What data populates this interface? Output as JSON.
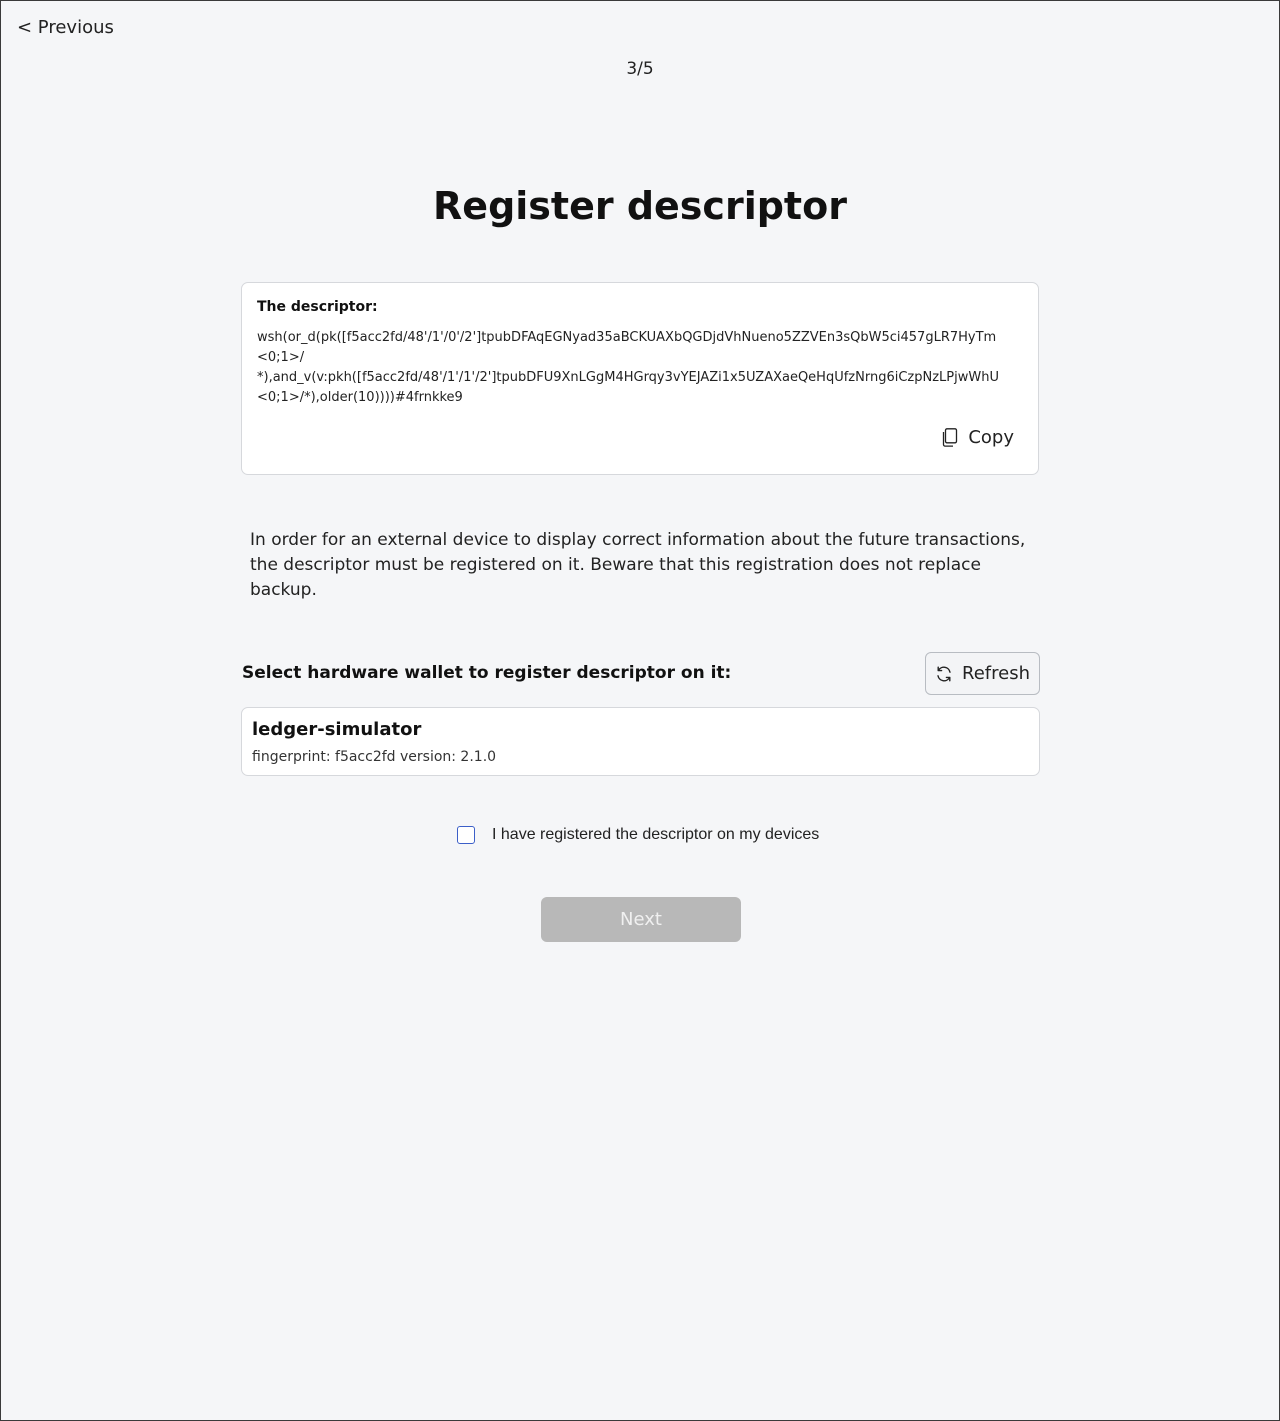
{
  "nav": {
    "previous_label": "< Previous",
    "step": "3/5"
  },
  "page": {
    "title": "Register descriptor"
  },
  "descriptor": {
    "label": "The descriptor:",
    "lines": [
      "wsh(or_d(pk([f5acc2fd/48'/1'/0'/2']tpubDFAqEGNyad35aBCKUAXbQGDjdVhNueno5ZZVEn3sQbW5ci457gLR7HyTm",
      "<0;1>/",
      "*),and_v(v:pkh([f5acc2fd/48'/1'/1'/2']tpubDFU9XnLGgM4HGrqy3vYEJAZi1x5UZAXaeQeHqUfzNrng6iCzpNzLPjwWhU",
      "<0;1>/*),older(10))))#4frnkke9"
    ],
    "copy_label": "Copy"
  },
  "info_text": "In order for an external device to display correct information about the future transactions, the descriptor must be registered on it. Beware that this registration does not replace backup.",
  "hardware": {
    "select_label": "Select hardware wallet to register descriptor on it:",
    "refresh_label": "Refresh",
    "devices": [
      {
        "name": "ledger-simulator",
        "meta": "fingerprint: f5acc2fd version: 2.1.0"
      }
    ]
  },
  "confirm": {
    "label": "I have registered the descriptor on my devices",
    "checked": false
  },
  "next_label": "Next",
  "colors": {
    "background": "#f5f6f8",
    "checkbox_border": "#3c5fc8",
    "disabled_button": "#b8b8b8"
  },
  "icons": {
    "copy": "copy-icon",
    "refresh": "refresh-icon"
  }
}
